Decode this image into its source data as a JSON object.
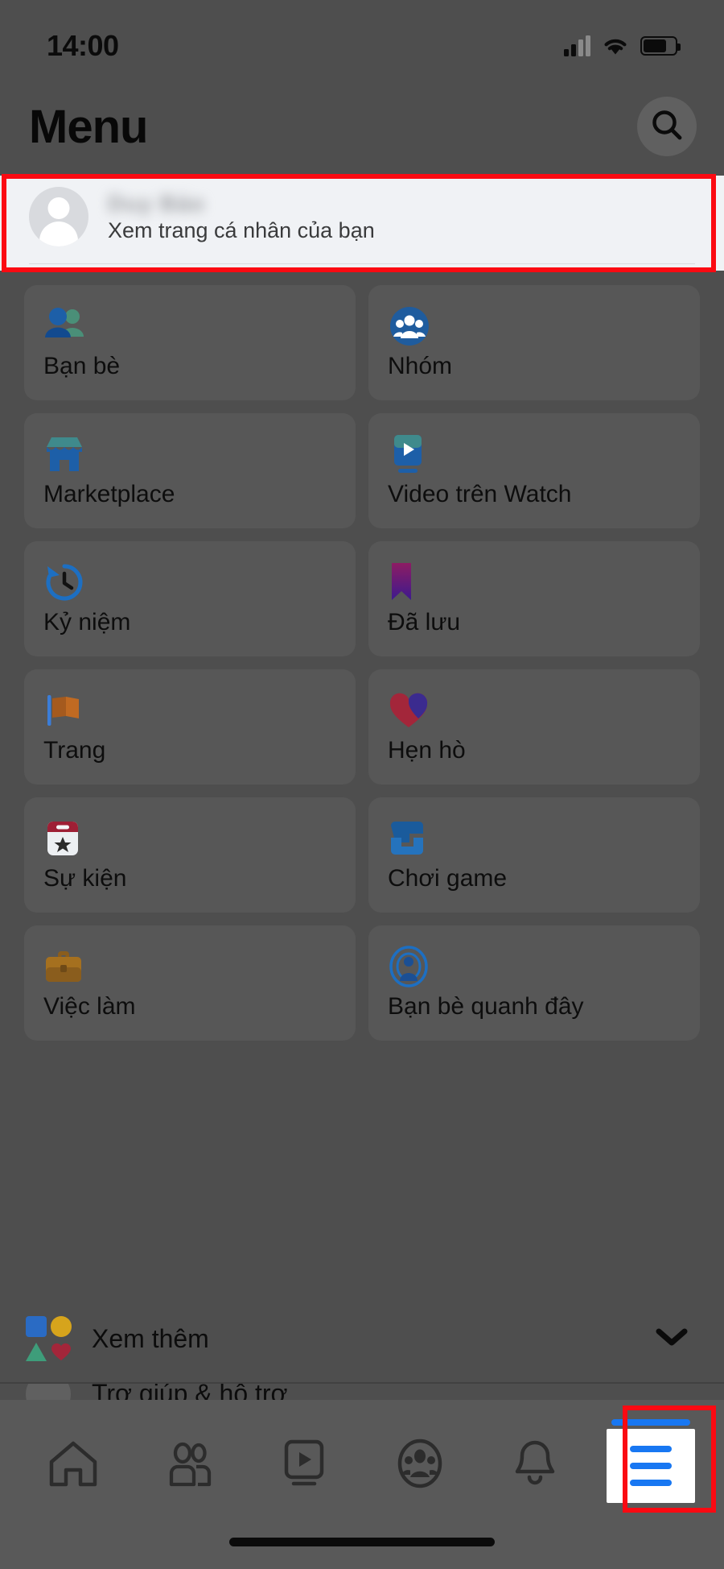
{
  "status_bar": {
    "time": "14:00",
    "signal_icon": "cellular-signal-icon",
    "wifi_icon": "wifi-icon",
    "battery_icon": "battery-icon"
  },
  "header": {
    "title": "Menu",
    "search_icon": "search-icon"
  },
  "profile": {
    "name": "",
    "subtitle": "Xem trang cá nhân của bạn",
    "avatar_icon": "avatar-placeholder-icon"
  },
  "menu_grid": [
    {
      "label": "Bạn bè",
      "icon": "friends-icon"
    },
    {
      "label": "Nhóm",
      "icon": "groups-icon"
    },
    {
      "label": "Marketplace",
      "icon": "marketplace-store-icon"
    },
    {
      "label": "Video trên Watch",
      "icon": "watch-video-icon"
    },
    {
      "label": "Kỷ niệm",
      "icon": "memories-clock-icon"
    },
    {
      "label": "Đã lưu",
      "icon": "saved-bookmark-icon"
    },
    {
      "label": "Trang",
      "icon": "pages-flag-icon"
    },
    {
      "label": "Hẹn hò",
      "icon": "dating-heart-icon"
    },
    {
      "label": "Sự kiện",
      "icon": "events-calendar-icon"
    },
    {
      "label": "Chơi game",
      "icon": "gaming-icon"
    },
    {
      "label": "Việc làm",
      "icon": "jobs-briefcase-icon"
    },
    {
      "label": "Bạn bè quanh đây",
      "icon": "nearby-friends-radar-icon"
    }
  ],
  "see_more": {
    "label": "Xem thêm",
    "icon": "four-shapes-icon",
    "chevron_icon": "chevron-down-icon"
  },
  "partial_row": {
    "label": "Trợ giúp & hỗ trợ",
    "icon": "help-circle-icon"
  },
  "bottom_nav": [
    {
      "icon": "home-icon",
      "active": false
    },
    {
      "icon": "friends-nav-icon",
      "active": false
    },
    {
      "icon": "watch-nav-icon",
      "active": false
    },
    {
      "icon": "groups-nav-icon",
      "active": false
    },
    {
      "icon": "notifications-bell-icon",
      "active": false
    },
    {
      "icon": "hamburger-menu-icon",
      "active": true
    }
  ],
  "annotations": {
    "highlight_color": "#fb0a12",
    "targets": [
      "profile-card",
      "menu-tab-button"
    ]
  },
  "colors": {
    "dim_overlay": "#4e4e4e",
    "facebook_blue": "#1877f2",
    "card_background": "#f0f2f5",
    "nav_background": "#595959"
  }
}
